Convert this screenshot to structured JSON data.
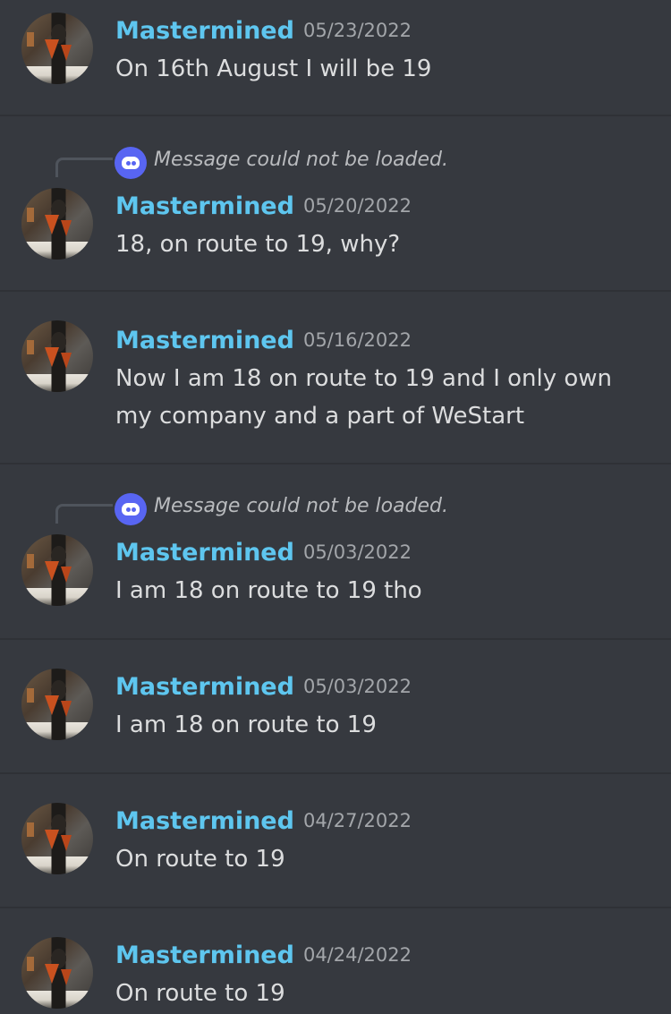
{
  "reply_note": "Message could not be loaded.",
  "messages": [
    {
      "author": "Mastermined",
      "timestamp": "05/23/2022",
      "text": "On 16th August I will be 19"
    },
    {
      "author": "Mastermined",
      "timestamp": "05/20/2022",
      "text": "18, on route to 19, why?"
    },
    {
      "author": "Mastermined",
      "timestamp": "05/16/2022",
      "text": "Now I am 18 on route to 19 and I only own my company and a part of WeStart"
    },
    {
      "author": "Mastermined",
      "timestamp": "05/03/2022",
      "text": "I am 18 on route to 19 tho"
    },
    {
      "author": "Mastermined",
      "timestamp": "05/03/2022",
      "text": "I am 18 on route to 19"
    },
    {
      "author": "Mastermined",
      "timestamp": "04/27/2022",
      "text": "On route to 19"
    },
    {
      "author": "Mastermined",
      "timestamp": "04/24/2022",
      "text": "On route to 19"
    }
  ],
  "colors": {
    "background": "#36393f",
    "author": "#5ec6ef",
    "timestamp": "#a3a6aa",
    "divider": "#2f3136",
    "discord_blurple": "#5865f2"
  }
}
